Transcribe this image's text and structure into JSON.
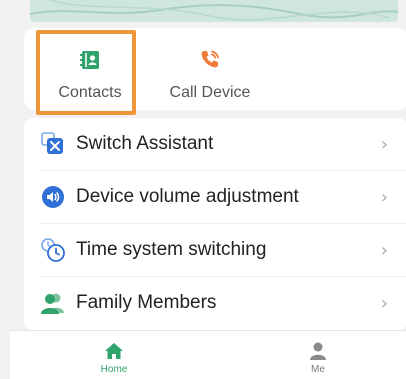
{
  "quick_actions": {
    "contacts_label": "Contacts",
    "call_label": "Call Device",
    "contacts_icon": "contacts-book-icon",
    "call_icon": "phone-call-icon"
  },
  "menu": {
    "items": [
      {
        "label": "Switch Assistant",
        "icon": "switch-assistant-icon"
      },
      {
        "label": "Device volume adjustment",
        "icon": "volume-icon"
      },
      {
        "label": "Time system switching",
        "icon": "time-system-icon"
      },
      {
        "label": "Family Members",
        "icon": "family-members-icon"
      }
    ],
    "chevron": "›"
  },
  "tabbar": {
    "home_label": "Home",
    "me_label": "Me"
  },
  "colors": {
    "accent_green": "#2fa36b",
    "highlight_orange": "#f0963a",
    "call_orange": "#f07c3a",
    "icon_blue": "#2f6fd6"
  }
}
